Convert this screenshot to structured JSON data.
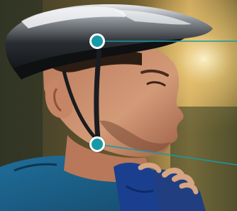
{
  "image": {
    "subject": "cyclist-fastening-helmet-strap",
    "helmet_color": "#1c1f22",
    "jersey_color": "#1c5e86",
    "glove_color": "#1b3f8f"
  },
  "hotspots": [
    {
      "id": "helmet-shell",
      "icon": "hotspot-dot",
      "color": "#1899a6"
    },
    {
      "id": "chin-strap",
      "icon": "hotspot-dot",
      "color": "#1899a6"
    }
  ],
  "leader_line_color": "#1899a6"
}
